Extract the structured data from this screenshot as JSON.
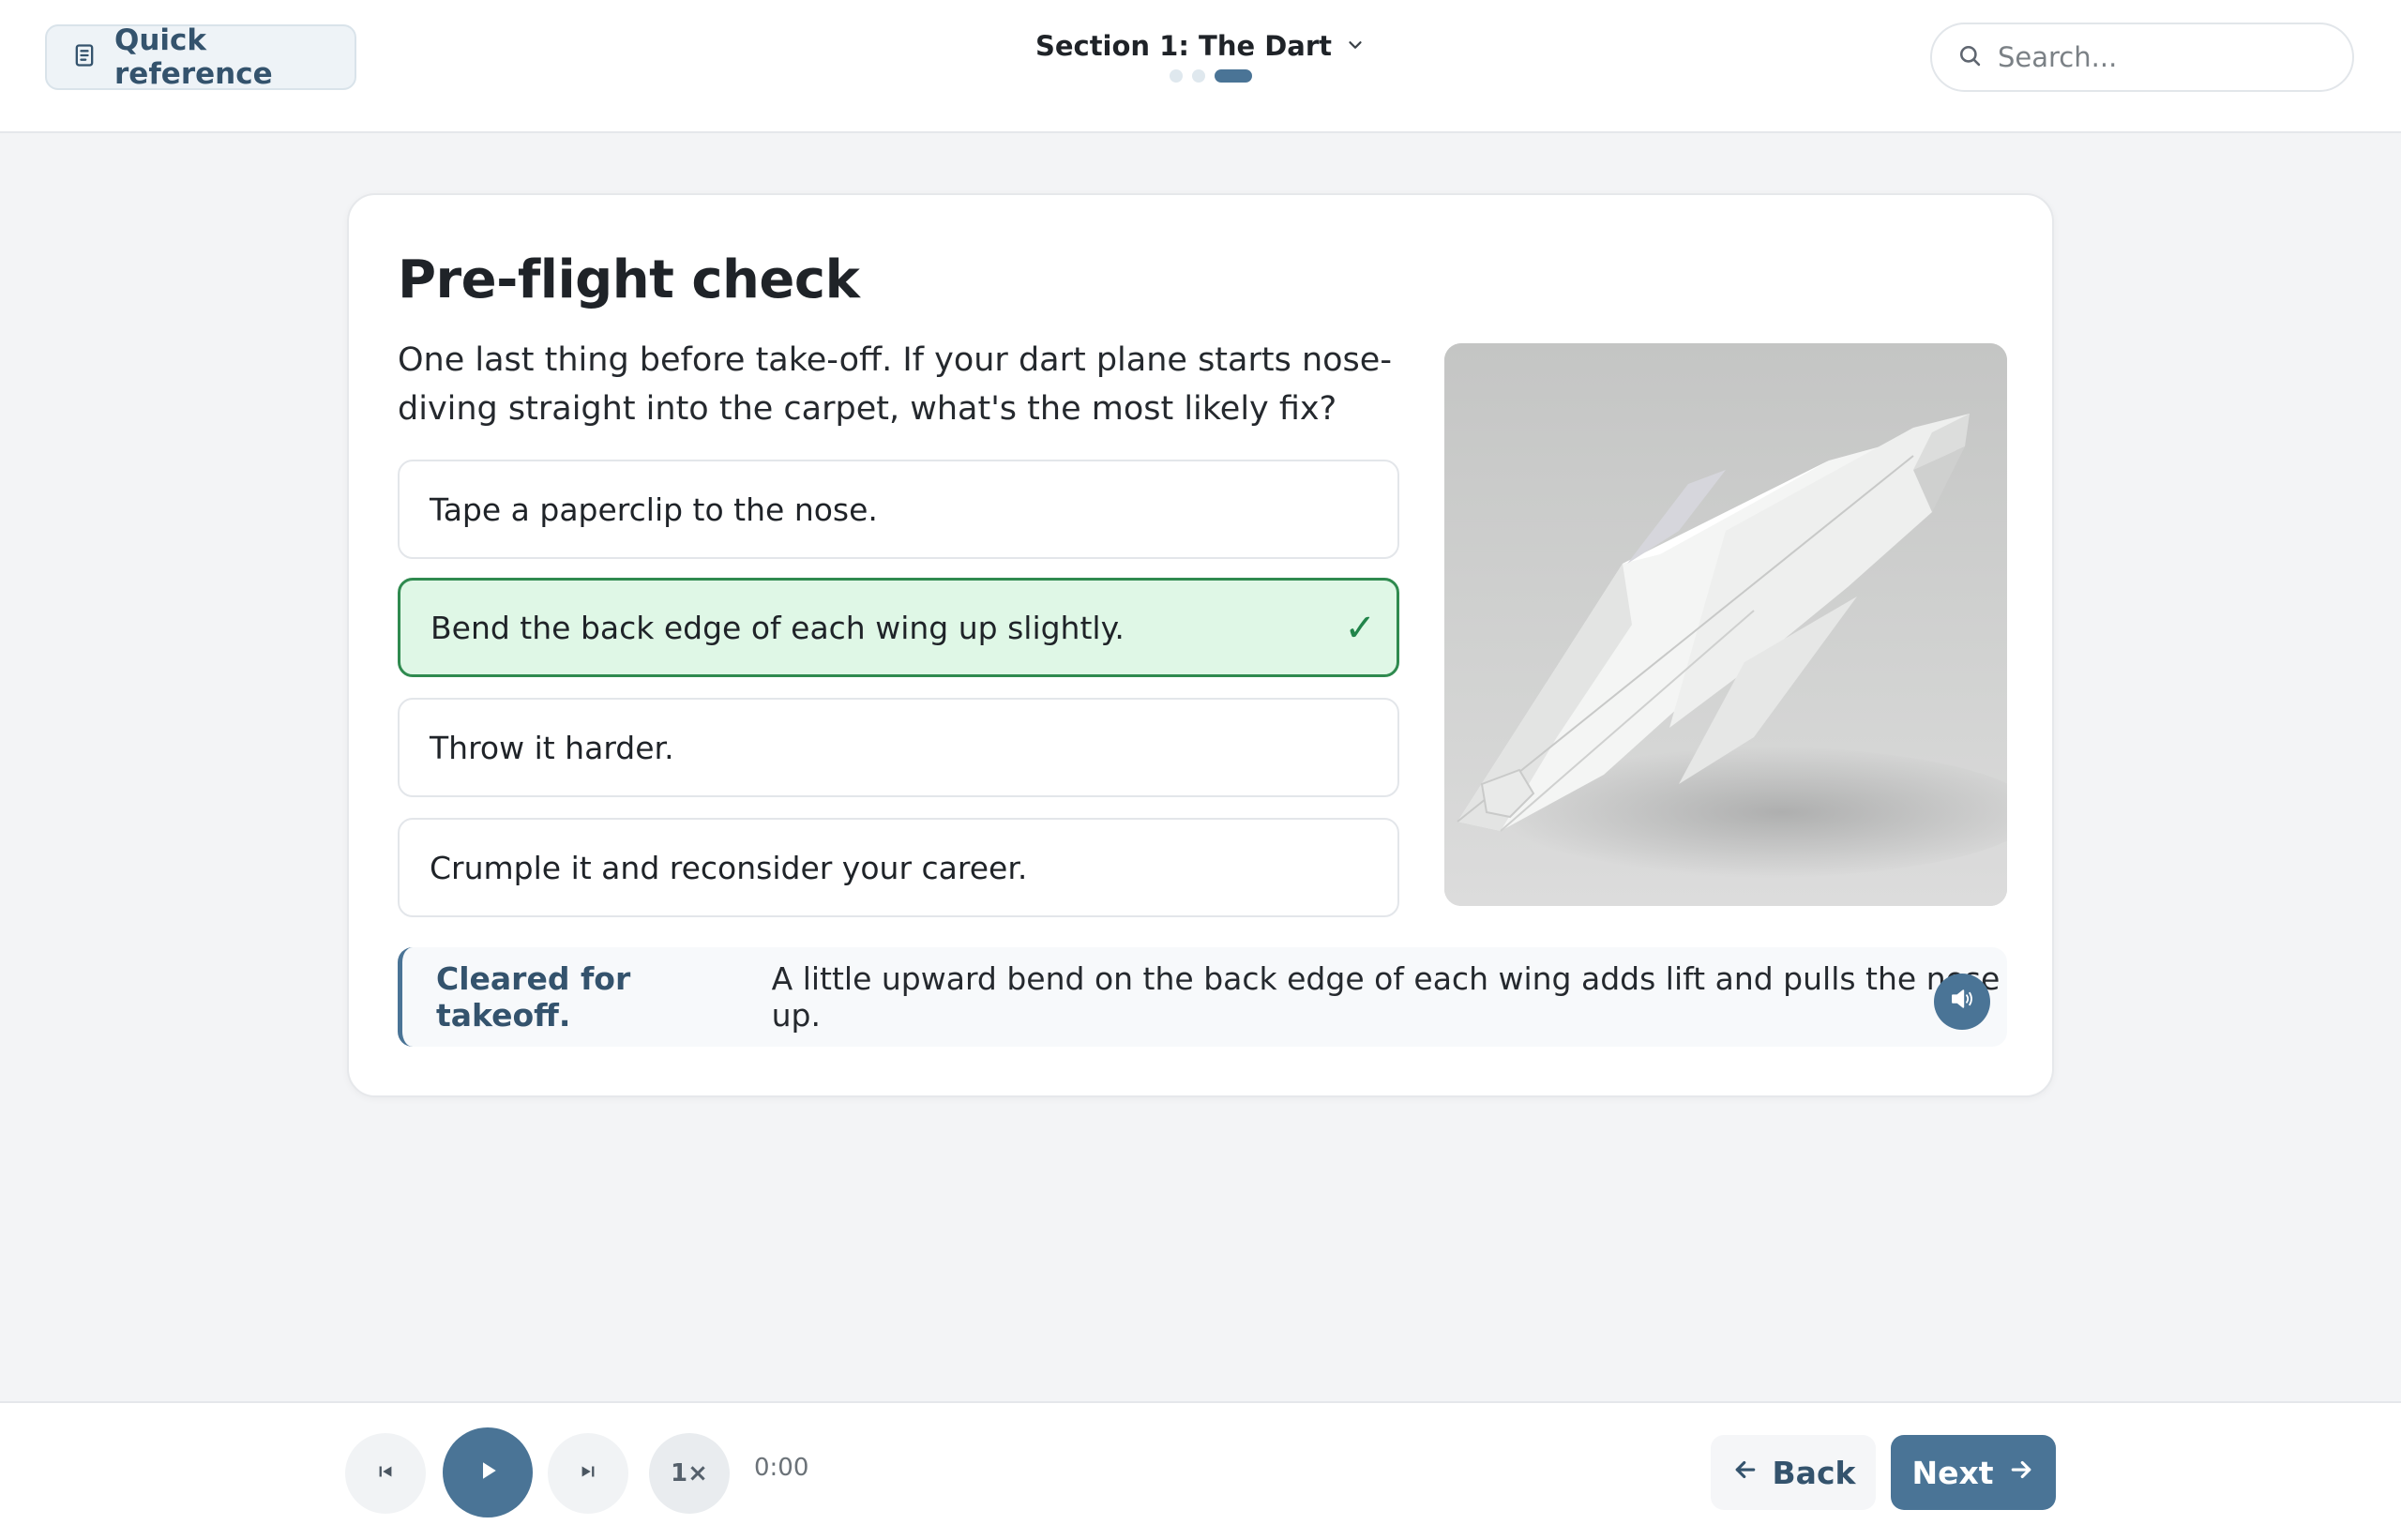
{
  "header": {
    "quick_reference_label": "Quick reference",
    "section_title": "Section 1: The Dart",
    "progress": {
      "total_steps": 3,
      "current_step": 3
    },
    "search_placeholder": "Search..."
  },
  "question": {
    "title": "Pre-flight check",
    "prompt": "One last thing before take-off. If your dart plane starts nose-diving straight into the carpet, what's the most likely fix?",
    "options": [
      {
        "label": "Tape a paperclip to the nose.",
        "state": "default"
      },
      {
        "label": "Bend the back edge of each wing up slightly.",
        "state": "correct"
      },
      {
        "label": "Throw it harder.",
        "state": "default"
      },
      {
        "label": "Crumple it and reconsider your career.",
        "state": "default"
      }
    ],
    "correct_mark": "✓",
    "image": {
      "subject": "white paper dart airplane nose-down on the floor",
      "icon": "paper-plane-photo"
    }
  },
  "feedback": {
    "lead": "Cleared for takeoff.",
    "text": "A little upward bend on the back edge of each wing adds lift and pulls the nose up.",
    "audio_icon": "speaker-icon"
  },
  "player": {
    "speed_label": "1×",
    "time": "0:00"
  },
  "nav": {
    "back_label": "Back",
    "next_label": "Next"
  },
  "colors": {
    "accent": "#4a7496",
    "correct_bg": "#dff7e6",
    "correct_border": "#2f8a4f",
    "page_bg": "#f3f4f6"
  }
}
